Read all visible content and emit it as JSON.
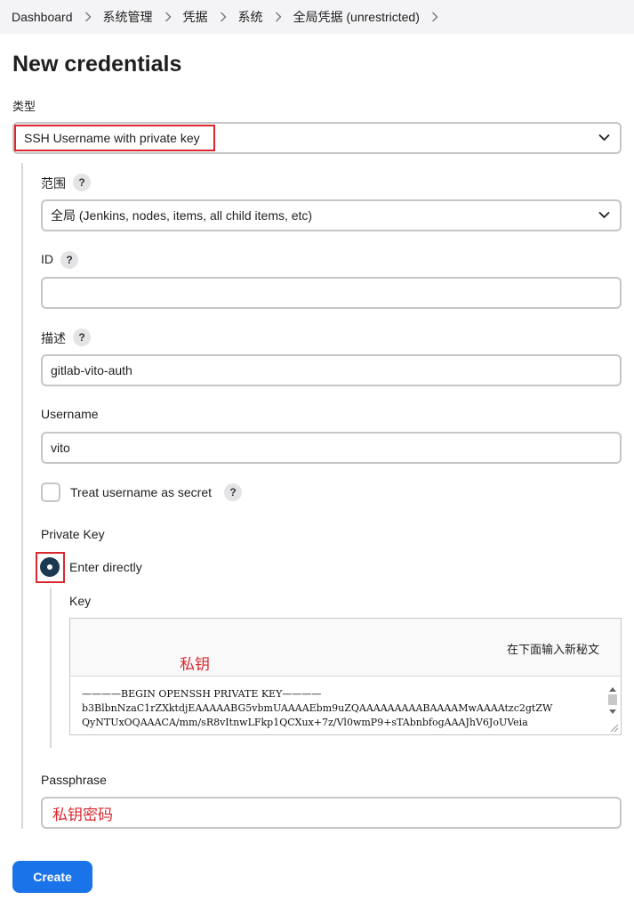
{
  "breadcrumb": [
    "Dashboard",
    "系统管理",
    "凭据",
    "系统",
    "全局凭据 (unrestricted)"
  ],
  "page": {
    "title": "New credentials"
  },
  "form": {
    "kind_label": "类型",
    "kind_value": "SSH Username with private key",
    "scope_label": "范围",
    "scope_value": "全局 (Jenkins, nodes, items, all child items, etc)",
    "id_label": "ID",
    "id_value": "",
    "description_label": "描述",
    "description_value": "gitlab-vito-auth",
    "username_label": "Username",
    "username_value": "vito",
    "treat_secret_label": "Treat username as secret",
    "private_key_label": "Private Key",
    "enter_directly_label": "Enter directly",
    "key_label": "Key",
    "key_hint": "在下面输入新秘文",
    "key_lines": [
      "————BEGIN OPENSSH PRIVATE KEY————",
      "b3BlbnNzaC1rZXktdjEAAAAABG5vbmUAAAAEbm9uZQAAAAAAAAABAAAAMwAAAAtzc2gtZW",
      "QyNTUxOQAAACA/mm/sR8vItnwLFkp1QCXux+7z/Vl0wmP9+sTAbnbfogAAAJhV6JoUVeia"
    ],
    "passphrase_label": "Passphrase",
    "help_glyph": "?"
  },
  "annotations": {
    "private_key_note": "私钥",
    "passphrase_note": "私钥密码"
  },
  "actions": {
    "create_label": "Create"
  },
  "colors": {
    "accent": "#1a73e8",
    "annotation": "#d9282f",
    "radio": "#1b3a52"
  }
}
